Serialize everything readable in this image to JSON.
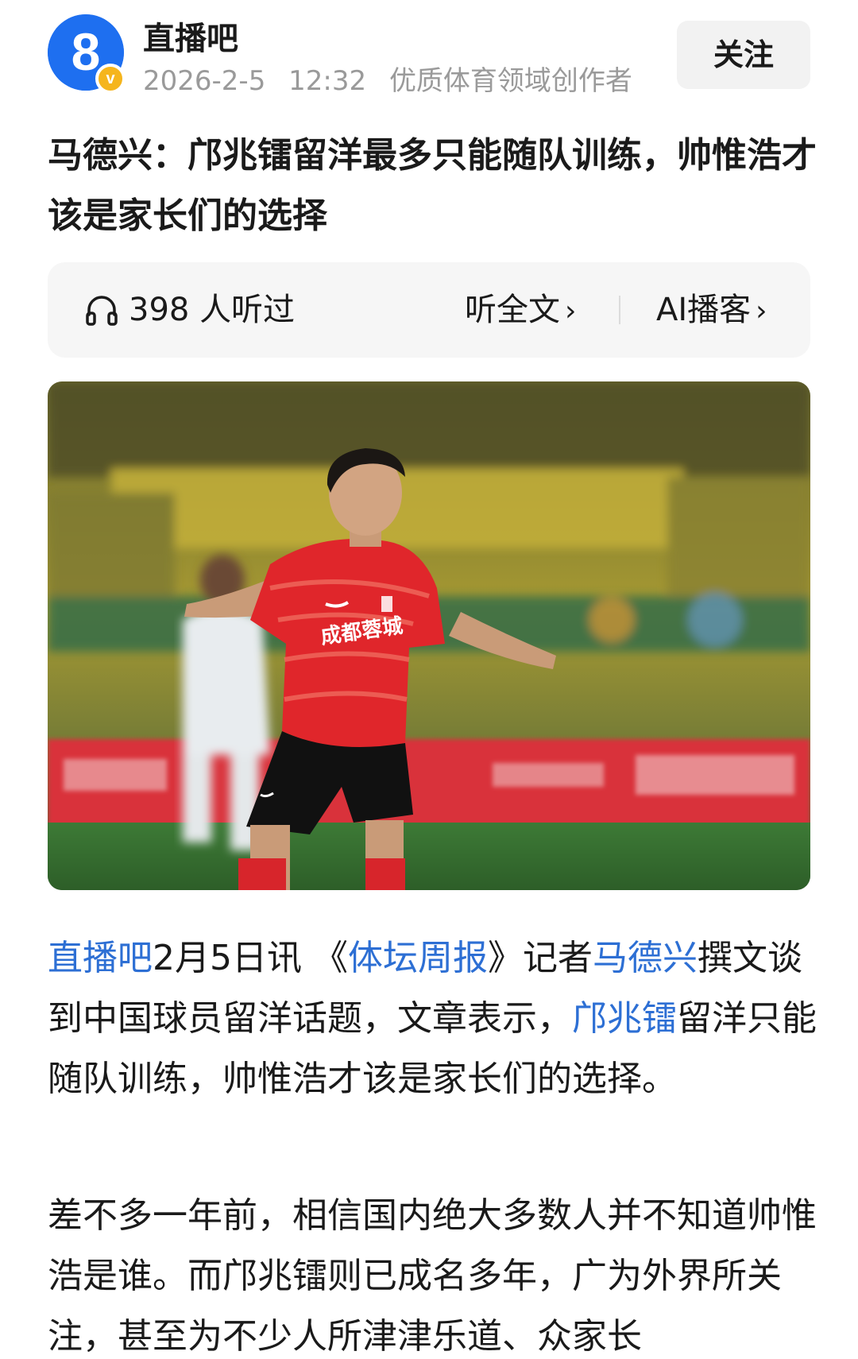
{
  "author": {
    "name": "直播吧",
    "date": "2026-2-5",
    "time": "12:32",
    "tagline": "优质体育领域创作者",
    "avatar_label": "8",
    "verified_badge": "v",
    "follow_label": "关注"
  },
  "article": {
    "title": "马德兴：邝兆镭留洋最多只能随队训练，帅惟浩才该是家长们的选择"
  },
  "audio": {
    "icon": "headphone-icon",
    "listen_count": "398 人听过",
    "full_text_label": "听全文",
    "ai_podcast_label": "AI播客",
    "chevron": "›"
  },
  "photo": {
    "jersey_text": "成都蓉城"
  },
  "body": {
    "p1": {
      "source": "直播吧",
      "lead": "2月5日讯 《",
      "publication": "体坛周报",
      "mid": "》记者",
      "reporter": "马德兴",
      "text1": "撰文谈到中国球员留洋话题，文章表示，",
      "player": "邝兆镭",
      "text2": "留洋只能随队训练，帅惟浩才该是家长们的选择。"
    },
    "p2": "差不多一年前，相信国内绝大多数人并不知道帅惟浩是谁。而邝兆镭则已成名多年，广为外界所关注，甚至为不少人所津津乐道、众家长"
  },
  "colors": {
    "link": "#2d6fd4",
    "brand": "#1e6ff0",
    "badge": "#f5b51d",
    "jersey": "#e0262b"
  }
}
